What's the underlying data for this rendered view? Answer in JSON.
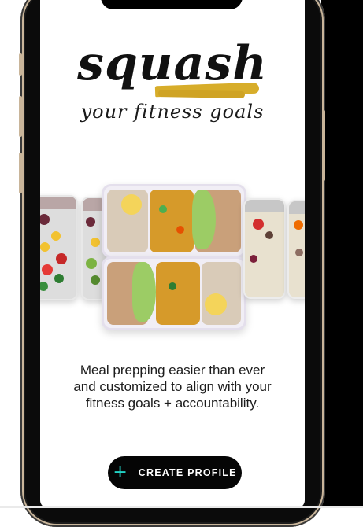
{
  "app": {
    "logo_text": "squash",
    "tagline": "your fitness goals"
  },
  "hero": {
    "image_description_icon": "meal-prep-containers-image"
  },
  "intro": {
    "description": "Meal prepping easier than ever and customized to align with your fitness goals + accountability."
  },
  "cta": {
    "icon": "plus-icon",
    "label": "CREATE PROFILE"
  },
  "colors": {
    "brand_brush": "#d7ad2a",
    "button_bg": "#050505",
    "button_icon": "#22d3c5",
    "text": "#1c1c1c"
  }
}
